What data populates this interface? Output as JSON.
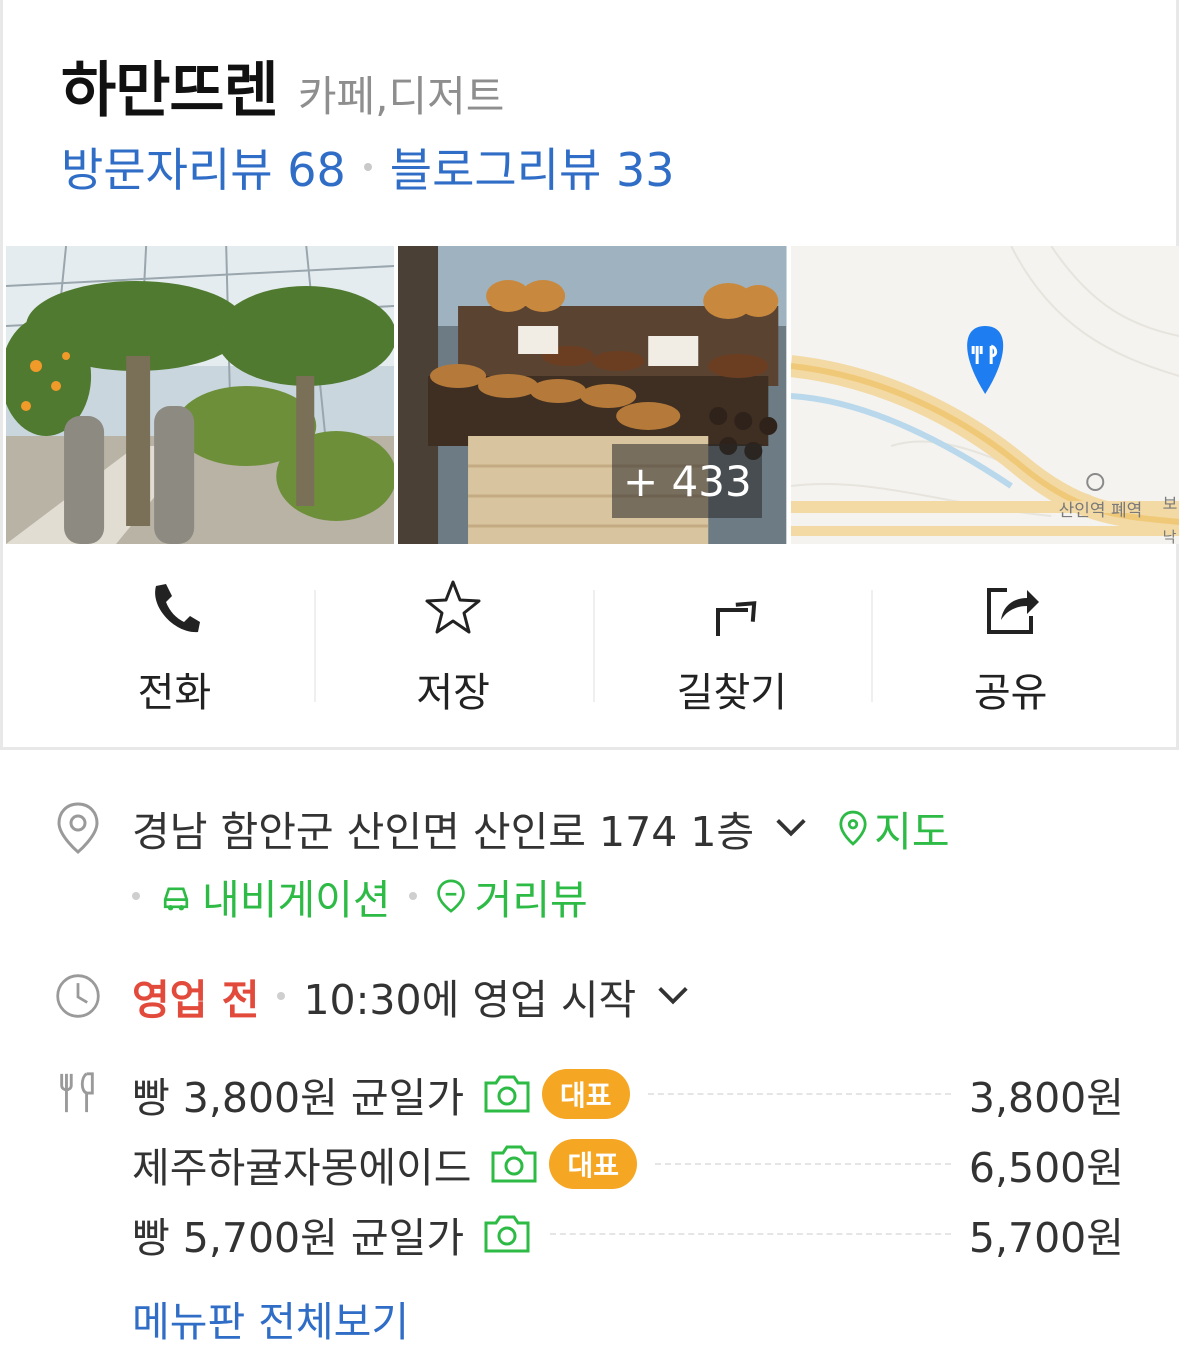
{
  "place": {
    "name": "하만뜨렌",
    "category": "카페,디저트"
  },
  "reviews": {
    "visitor": "방문자리뷰 68",
    "blog": "블로그리뷰 33"
  },
  "photos": {
    "more_count": "+ 433",
    "map_station_label": "산인역 폐역",
    "map_edge_label_1": "보",
    "map_edge_label_2": "낙"
  },
  "actions": [
    {
      "label": "전화",
      "icon": "phone-icon"
    },
    {
      "label": "저장",
      "icon": "star-icon"
    },
    {
      "label": "길찾기",
      "icon": "directions-icon"
    },
    {
      "label": "공유",
      "icon": "share-icon"
    }
  ],
  "address": {
    "text": "경남 함안군 산인면 산인로 174 1층",
    "map_link": "지도",
    "navigation_link": "내비게이션",
    "streetview_link": "거리뷰"
  },
  "hours": {
    "status": "영업 전",
    "detail": "10:30에 영업 시작"
  },
  "menu": {
    "items": [
      {
        "name": "빵 3,800원 균일가",
        "badge": "대표",
        "price": "3,800원"
      },
      {
        "name": "제주하귤자몽에이드",
        "badge": "대표",
        "price": "6,500원"
      },
      {
        "name": "빵 5,700원 균일가",
        "badge": "",
        "price": "5,700원"
      }
    ],
    "view_all": "메뉴판 전체보기"
  },
  "colors": {
    "link_blue": "#2f6dc6",
    "green": "#2dbb46",
    "status_red": "#e24a3b",
    "badge_orange": "#f5a623",
    "map_pin_blue": "#1e7df0"
  }
}
